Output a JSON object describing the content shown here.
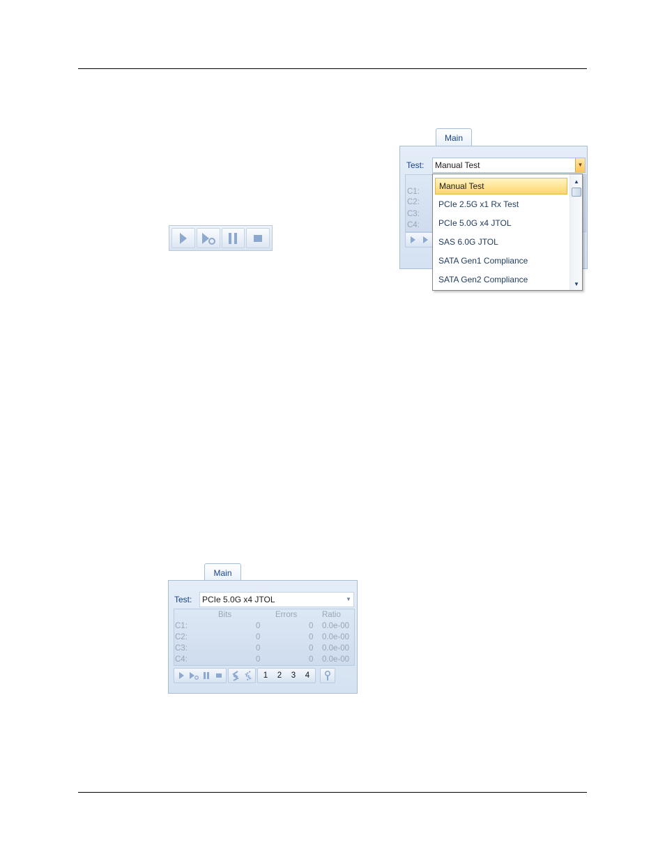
{
  "top_panel": {
    "tab_label": "Main",
    "test_label": "Test:",
    "selected_test": "Manual Test",
    "channel_labels": [
      "C1:",
      "C2:",
      "C3:",
      "C4:"
    ],
    "dropdown_items": [
      "Manual Test",
      "PCIe 2.5G x1 Rx Test",
      "PCIe 5.0G x4 JTOL",
      "SAS 6.0G JTOL",
      "SATA Gen1 Compliance",
      "SATA Gen2 Compliance"
    ],
    "highlighted_item": "Manual Test"
  },
  "mini_toolbar": {
    "buttons": [
      "play-icon",
      "play-to-end-icon",
      "pause-icon",
      "stop-icon"
    ]
  },
  "bottom_panel": {
    "tab_label": "Main",
    "test_label": "Test:",
    "selected_test": "PCIe 5.0G x4 JTOL",
    "columns": [
      "Bits",
      "Errors",
      "Ratio"
    ],
    "rows": [
      {
        "label": "C1:",
        "bits": "0",
        "errors": "0",
        "ratio": "0.0e-00"
      },
      {
        "label": "C2:",
        "bits": "0",
        "errors": "0",
        "ratio": "0.0e-00"
      },
      {
        "label": "C3:",
        "bits": "0",
        "errors": "0",
        "ratio": "0.0e-00"
      },
      {
        "label": "C4:",
        "bits": "0",
        "errors": "0",
        "ratio": "0.0e-00"
      }
    ],
    "channel_buttons": [
      "1",
      "2",
      "3",
      "4"
    ]
  },
  "colors": {
    "ribbon_border": "#a6bcd7",
    "ribbon_fill": "#dbe6f4",
    "highlight": "#ffd66b",
    "icon_blue": "#8da8cf"
  }
}
